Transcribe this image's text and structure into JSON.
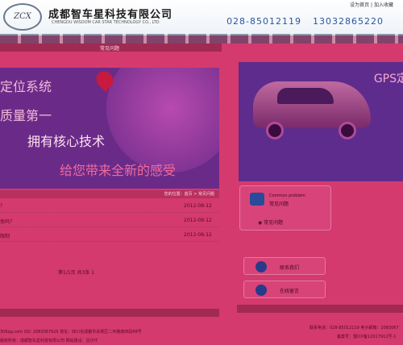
{
  "header": {
    "logo_text": "ZCX",
    "company_name": "成都智车星科技有限公司",
    "company_name_en": "CHENGDU WISDOM CAR STAR TECHNOLOGY CO., LTD",
    "set_home": "设为首页",
    "add_favorite": "加入收藏",
    "phones": [
      "028-85012119",
      "13032865220"
    ]
  },
  "nav": {
    "items": [
      "常见问题"
    ]
  },
  "banner_left": {
    "line1": "定位系统",
    "line2": "质量第一",
    "line3": "拥有核心技术",
    "line4": "给您带来全新的感受"
  },
  "banner_right": {
    "gps_text": "GPS定"
  },
  "news": {
    "head": "您的位置：首页 > 常见问题",
    "rows": [
      {
        "title": "?",
        "date": "2012-08-12"
      },
      {
        "title": "色吗？",
        "date": "2012-08-12"
      },
      {
        "title": "限制",
        "date": "2012-08-12"
      }
    ],
    "pager": "第1/1页 共3条 1"
  },
  "faq_box": {
    "title_en": "Common problem",
    "title_cn": "常见问题",
    "item": "常见问题"
  },
  "side_buttons": {
    "contact": "联系我们",
    "message": "在线留言"
  },
  "footer": {
    "left_line1": "306qq.com QQ: 2083067925 地址：四川省成都市武侯区二环路南四段88号",
    "left_line2": "版权所有：成都智车星科技有限公司 网站建设：且尔IT",
    "right_line1": "联系电话：028-85012119 电子邮箱：2083067",
    "right_line2": "备案号：蜀ICP备12017912号-1"
  }
}
